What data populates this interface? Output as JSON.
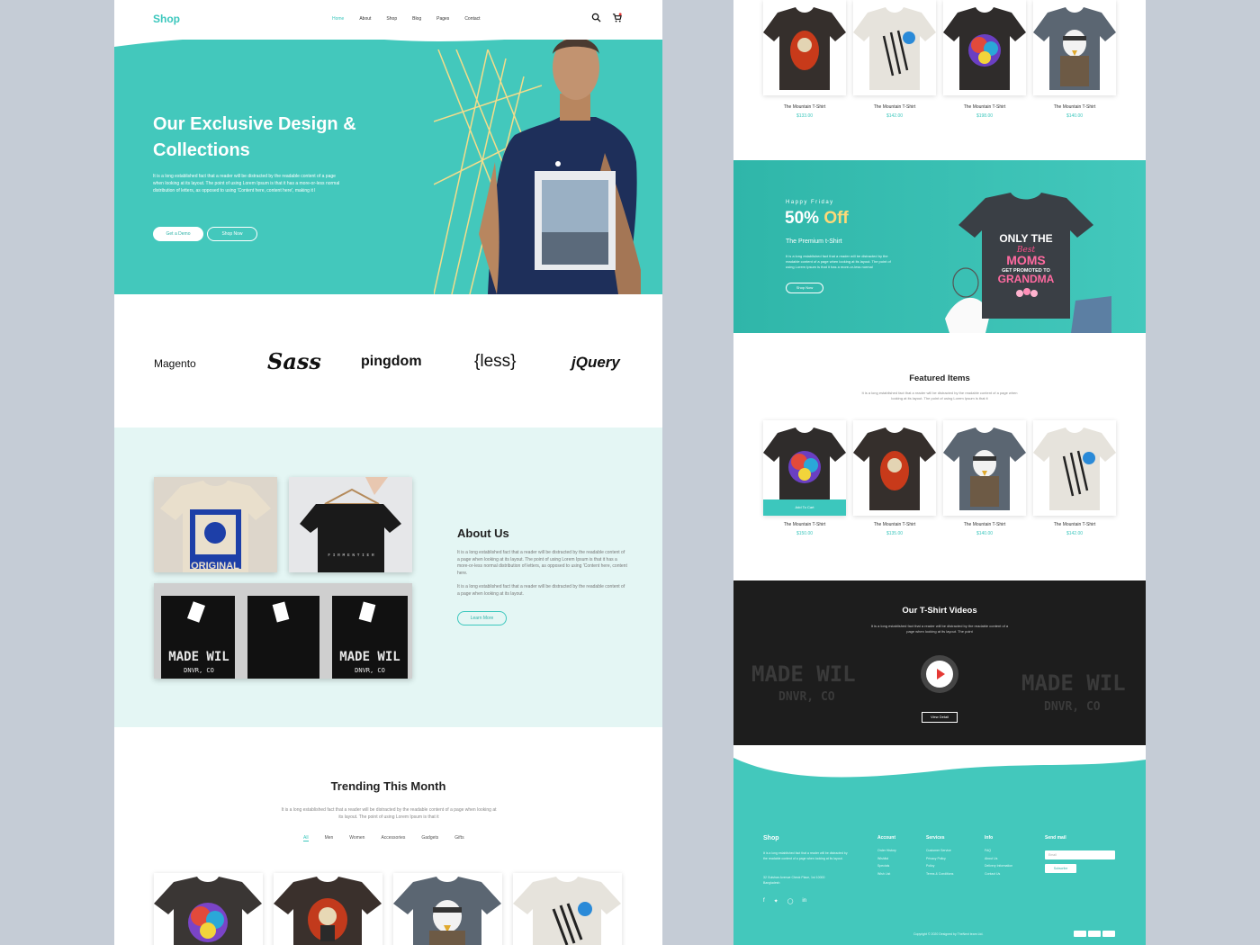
{
  "header": {
    "logo": "Shop",
    "nav": [
      "Home",
      "About",
      "Shop",
      "Blog",
      "Pages",
      "Contact"
    ]
  },
  "hero": {
    "title": "Our Exclusive Design & Collections",
    "text": "It is a long established fact that a reader will be distracted by the readable content of a page when looking at its layout. The point of using Lorem Ipsum is that it has a more-or-less normal distribution of letters, as opposed to using 'Content here, content here', making it l",
    "btn_demo": "Get a Demo",
    "btn_shop": "Shop Now"
  },
  "brands": [
    "Magento",
    "Sass",
    "pingdom",
    "{less}",
    "jQuery"
  ],
  "about": {
    "title": "About Us",
    "p1": "It is a long established fact that a reader will be distracted by the readable content of a page when looking at its layout. The point of using Lorem Ipsum is that it has a more-or-less normal distribution of letters, as opposed to using 'Content here, content here.",
    "p2": "It is a long established fact that a reader will be distracted by the readable content of a page when looking at its layout.",
    "btn": "Learn More",
    "photo_texts": [
      "ORIGINAL",
      "MADE WIL",
      "DNVR, CO"
    ]
  },
  "trending": {
    "title": "Trending This Month",
    "subtitle": "It is a long established fact that a reader will be distracted by the readable content of a page when looking at its layout. The point of using Lorem Ipsum is that it",
    "tabs": [
      "All",
      "Men",
      "Women",
      "Accessories",
      "Gadgets",
      "Gifts"
    ]
  },
  "top_products": [
    {
      "name": "The Mountain T-Shirt",
      "price": "$133.00"
    },
    {
      "name": "The Mountain T-Shirt",
      "price": "$142.00"
    },
    {
      "name": "The Mountain T-Shirt",
      "price": "$198.00"
    },
    {
      "name": "The Mountain T-Shirt",
      "price": "$140.00"
    }
  ],
  "promo": {
    "small": "Happy Friday",
    "percent": "50%",
    "off": "Off",
    "subtitle": "The Premium t-Shirt",
    "text": "It is a long established fact that a reader will be distracted by the readable content of a page when looking at its layout. The point of using Lorem Ipsum is that it has a more-or-less normal",
    "btn": "Shop Now",
    "shirt_text": [
      "ONLY THE",
      "Best",
      "MOMS",
      "GET PROMOTED TO",
      "GRANDMA"
    ]
  },
  "featured": {
    "title": "Featured Items",
    "subtitle": "It is a long established fact that a reader will be distracted by the readable content of a page when looking at its layout. The point of using Lorem Ipsum is that it",
    "add_to_cart": "Add To Cart",
    "items": [
      {
        "name": "The Mountain T-Shirt",
        "price": "$150.00"
      },
      {
        "name": "The Mountain T-Shirt",
        "price": "$135.00"
      },
      {
        "name": "The Mountain T-Shirt",
        "price": "$140.00"
      },
      {
        "name": "The Mountain T-Shirt",
        "price": "$142.00"
      }
    ]
  },
  "video": {
    "title": "Our T-Shirt Videos",
    "subtitle": "It is a long established fact that a reader will be distracted by the readable content of a page when looking at its layout. The point",
    "btn": "View Detail",
    "bg_text": [
      "MADE WIL",
      "DNVR, CO"
    ]
  },
  "footer": {
    "logo": "Shop",
    "about": "It is a long established fact that a reader will be distracted by the readable content of a page when looking at its layout.",
    "address": "32 Gulshan Avenue Check Place, 1st 10000 Bangladesh",
    "columns": [
      {
        "title": "Account",
        "items": [
          "Order History",
          "Wishlist",
          "Specials",
          "Wish List"
        ]
      },
      {
        "title": "Services",
        "items": [
          "Customer Service",
          "Privacy Policy",
          "Policy",
          "Terms & Conditions"
        ]
      },
      {
        "title": "Info",
        "items": [
          "FAQ",
          "About Us",
          "Delivery Information",
          "Contact Us"
        ]
      }
    ],
    "mail_title": "Send mail",
    "email_placeholder": "Email",
    "subscribe": "Subscribe",
    "copyright": "Copyright © 2020 Designed by TheNext team Ltd."
  },
  "colors": {
    "accent": "#43c8bc",
    "promo_highlight": "#ffd978",
    "play": "#e53935"
  }
}
